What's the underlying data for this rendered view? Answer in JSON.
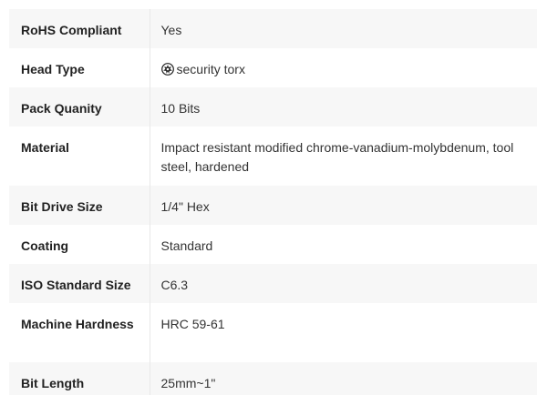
{
  "specs": [
    {
      "label": "RoHS Compliant",
      "value": "Yes"
    },
    {
      "label": "Head Type",
      "value": "security torx",
      "icon": "security-torx-icon"
    },
    {
      "label": "Pack Quanity",
      "value": "10 Bits"
    },
    {
      "label": "Material",
      "value": "Impact resistant modified chrome-vanadium-molybdenum, tool steel, hardened"
    },
    {
      "label": "Bit Drive Size",
      "value": "1/4\" Hex"
    },
    {
      "label": "Coating",
      "value": "Standard"
    },
    {
      "label": "ISO Standard Size",
      "value": "C6.3"
    },
    {
      "label": "Machine Hardness",
      "value": "HRC 59-61"
    },
    {
      "label": "Bit Length",
      "value": "25mm~1\""
    }
  ]
}
